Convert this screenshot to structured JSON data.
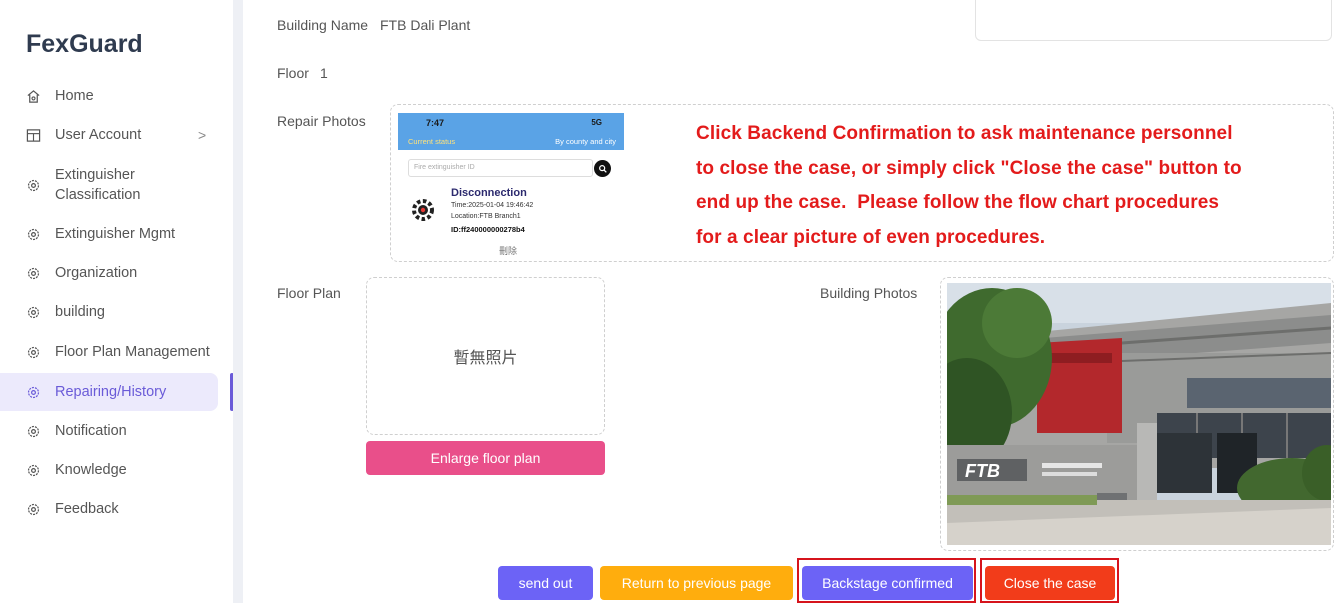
{
  "app": {
    "brand": "FexGuard"
  },
  "sidebar": {
    "items": [
      {
        "label": "Home",
        "icon": "home-icon"
      },
      {
        "label": "User Account",
        "icon": "table-icon",
        "chevron": ">"
      },
      {
        "label": "Extinguisher Classification",
        "line1": "Extinguisher",
        "line2": "Classification",
        "icon": "gear-icon"
      },
      {
        "label": "Extinguisher Mgmt",
        "icon": "gear-icon"
      },
      {
        "label": "Organization",
        "icon": "gear-icon"
      },
      {
        "label": "building",
        "icon": "gear-icon"
      },
      {
        "label": "Floor Plan Management",
        "icon": "gear-icon"
      },
      {
        "label": "Repairing/History",
        "icon": "gear-icon",
        "active": true
      },
      {
        "label": "Notification",
        "icon": "gear-icon"
      },
      {
        "label": "Knowledge",
        "icon": "gear-icon"
      },
      {
        "label": "Feedback",
        "icon": "gear-icon"
      }
    ]
  },
  "details": {
    "building_name_label": "Building Name",
    "building_name_value": "FTB Dali Plant",
    "floor_label": "Floor",
    "floor_value": "1",
    "repair_photos_label": "Repair Photos",
    "floor_plan_label": "Floor Plan",
    "building_photos_label": "Building Photos",
    "floor_plan_empty": "暫無照片",
    "enlarge_label": "Enlarge floor plan"
  },
  "phone": {
    "time": "7:47",
    "signal": "5G",
    "status": "Current status",
    "county": "By county and city",
    "search_placeholder": "Fire extinguisher ID",
    "event_title": "Disconnection",
    "event_time": "Time:2025-01-04 19:46:42",
    "event_location": "Location:FTB Branch1",
    "event_id": "ID:ff240000000278b4",
    "delete_label": "刪除"
  },
  "instruction": {
    "line1": "Click Backend Confirmation to ask maintenance personnel",
    "line2": "to close the case, or simply click \"Close the case\" button to",
    "line3": "end up the case.  Please follow the flow chart procedures",
    "line4": "for a clear picture of even procedures.",
    "color": "#e31b1b"
  },
  "building_photo": {
    "sign_text": "FTB"
  },
  "actions": {
    "send_out": "send out",
    "return": "Return to previous page",
    "backstage": "Backstage confirmed",
    "close": "Close the case"
  },
  "colors": {
    "accent": "#6c63f6",
    "enlarge": "#e94f8a",
    "return": "#ffad0d",
    "close": "#f23c1a",
    "highlight": "#d6141c"
  }
}
